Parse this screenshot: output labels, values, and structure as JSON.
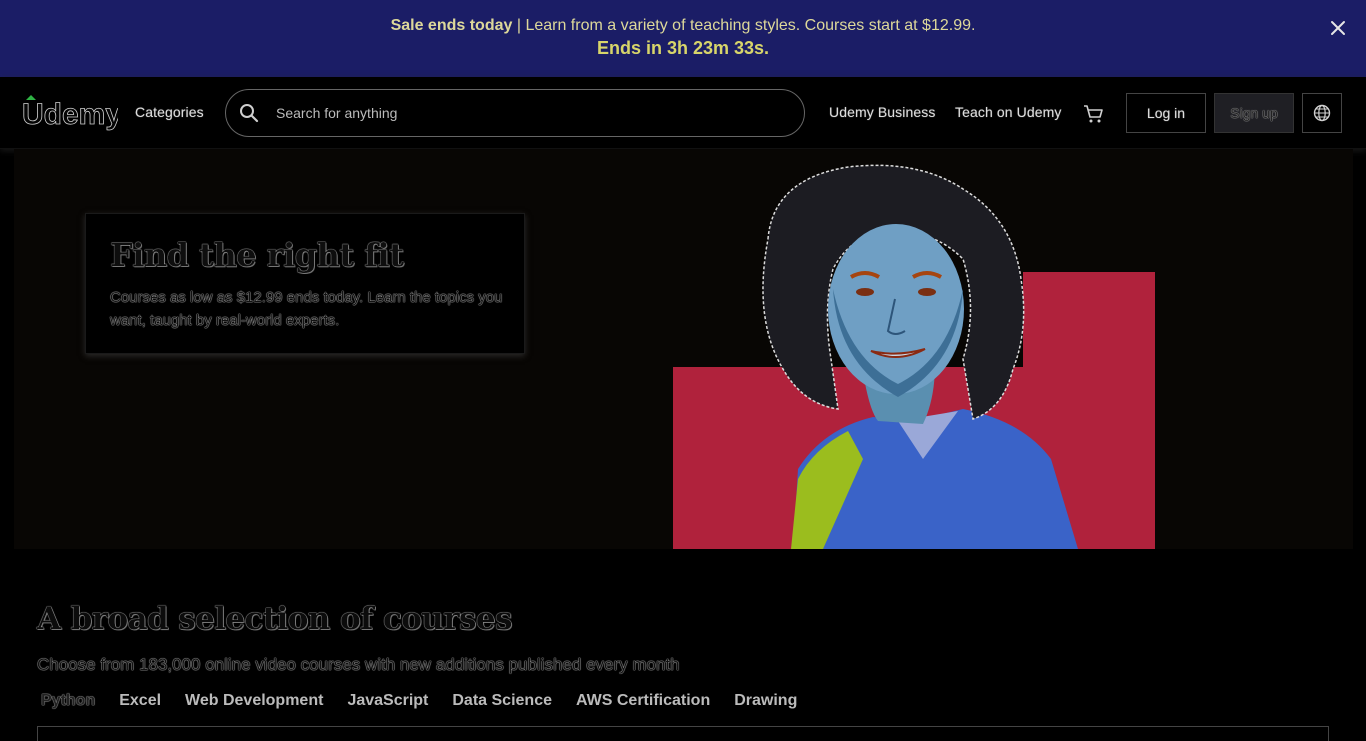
{
  "banner": {
    "sale_label": "Sale ends today",
    "separator": " | ",
    "message": "Learn from a variety of teaching styles. Courses start at $12.99.",
    "countdown": "Ends in 3h 23m 33s."
  },
  "header": {
    "logo_text": "Udemy",
    "categories_label": "Categories",
    "search_placeholder": "Search for anything",
    "business_label": "Udemy Business",
    "teach_label": "Teach on Udemy",
    "login_label": "Log in",
    "signup_label": "Sign up"
  },
  "hero": {
    "title": "Find the right fit",
    "subtitle": "Courses as low as $12.99 ends today. Learn the topics you want, taught by real-world experts."
  },
  "courses": {
    "title": "A broad selection of courses",
    "subtitle": "Choose from 183,000 online video courses with new additions published every month",
    "tabs": [
      {
        "label": "Python",
        "active": true
      },
      {
        "label": "Excel",
        "active": false
      },
      {
        "label": "Web Development",
        "active": false
      },
      {
        "label": "JavaScript",
        "active": false
      },
      {
        "label": "Data Science",
        "active": false
      },
      {
        "label": "AWS Certification",
        "active": false
      },
      {
        "label": "Drawing",
        "active": false
      }
    ]
  },
  "colors": {
    "banner_bg": "#1b1d66",
    "banner_text": "#d8d56a",
    "hero_red_block": "#b0223c",
    "logo_accent": "#2fb344"
  },
  "icons": [
    "close-icon",
    "search-icon",
    "cart-icon",
    "globe-icon"
  ]
}
